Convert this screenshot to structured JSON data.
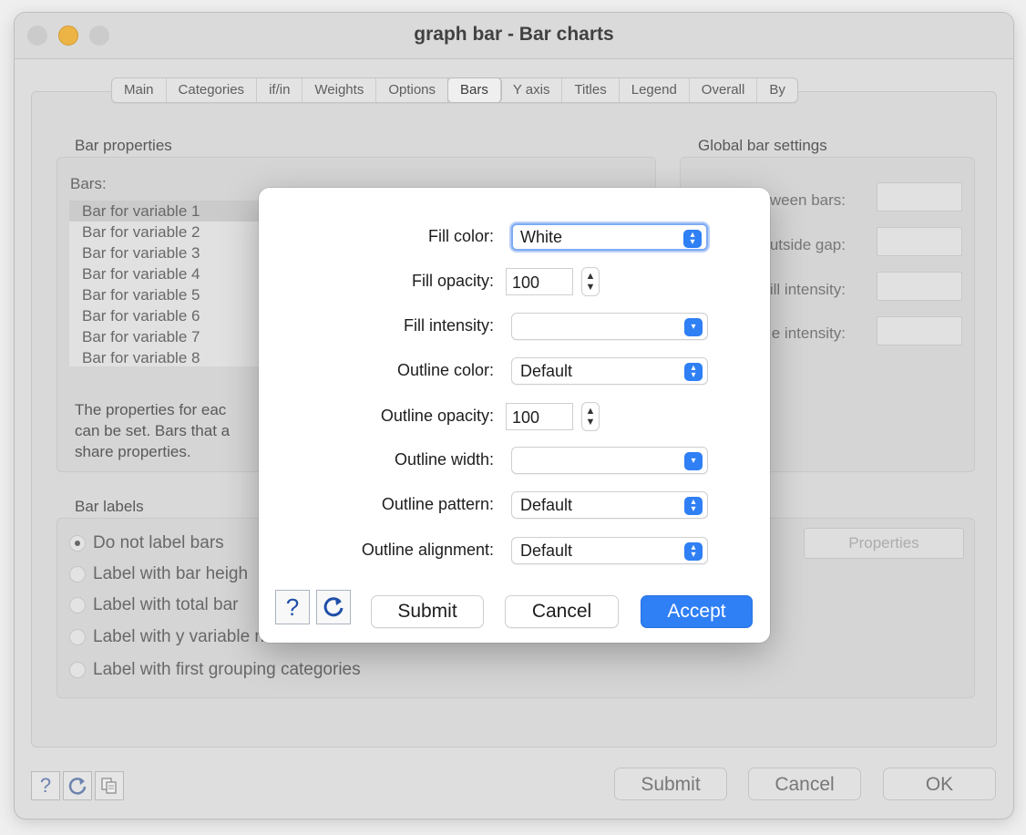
{
  "window": {
    "title": "graph bar - Bar charts"
  },
  "tabs": [
    "Main",
    "Categories",
    "if/in",
    "Weights",
    "Options",
    "Bars",
    "Y axis",
    "Titles",
    "Legend",
    "Overall",
    "By"
  ],
  "active_tab": "Bars",
  "bar_properties": {
    "heading": "Bar properties",
    "bars_label": "Bars:",
    "items": [
      "Bar for variable 1",
      "Bar for variable 2",
      "Bar for variable 3",
      "Bar for variable 4",
      "Bar for variable 5",
      "Bar for variable 6",
      "Bar for variable 7",
      "Bar for variable 8"
    ],
    "description": "The properties for eac\ncan be set. Bars that a\nshare properties."
  },
  "global_settings": {
    "heading": "Global bar settings",
    "rows": [
      "tween bars:",
      "utside gap:",
      "ill intensity:",
      "e intensity:"
    ]
  },
  "bar_labels": {
    "heading": "Bar labels",
    "options": [
      "Do not label bars",
      "Label with bar heigh",
      "Label with total bar",
      "Label with y variable name",
      "Label with first grouping categories"
    ],
    "selected": "Do not label bars",
    "properties_button": "Properties"
  },
  "window_buttons": {
    "submit": "Submit",
    "cancel": "Cancel",
    "ok": "OK"
  },
  "dialog": {
    "fill_color_label": "Fill color:",
    "fill_color_value": "White",
    "fill_opacity_label": "Fill opacity:",
    "fill_opacity_value": "100",
    "fill_intensity_label": "Fill intensity:",
    "fill_intensity_value": "",
    "outline_color_label": "Outline color:",
    "outline_color_value": "Default",
    "outline_opacity_label": "Outline opacity:",
    "outline_opacity_value": "100",
    "outline_width_label": "Outline width:",
    "outline_width_value": "",
    "outline_pattern_label": "Outline pattern:",
    "outline_pattern_value": "Default",
    "outline_alignment_label": "Outline alignment:",
    "outline_alignment_value": "Default",
    "help_glyph": "?",
    "submit": "Submit",
    "cancel": "Cancel",
    "accept": "Accept"
  },
  "colors": {
    "accent": "#2f7ff5",
    "minimize": "#fcbb3e"
  }
}
